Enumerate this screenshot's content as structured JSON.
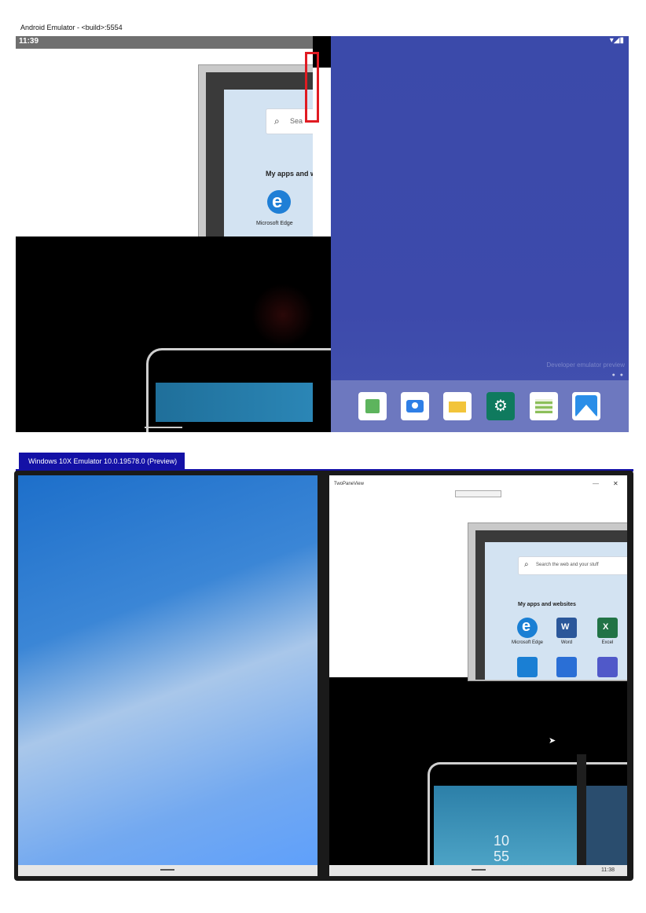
{
  "android": {
    "window_title": "Android Emulator - <build>:5554",
    "status_time": "11:39",
    "status_icons": "▾◢▮",
    "developer_preview": "Developer emulator preview",
    "page_dots": "● ●",
    "zoom": {
      "search_placeholder": "Sea",
      "section_title": "My apps and w",
      "edge_label": "Microsoft Edge"
    },
    "dock_apps": [
      {
        "name": "Phone/Contacts",
        "color": "#ffffff"
      },
      {
        "name": "Camera",
        "color": "#ffffff"
      },
      {
        "name": "Email",
        "color": "#ffffff"
      },
      {
        "name": "Settings",
        "color": "#0f7a5e"
      },
      {
        "name": "Spreadsheet",
        "color": "#ffffff"
      },
      {
        "name": "Photos",
        "color": "#ffffff"
      }
    ]
  },
  "windows": {
    "tab_title": "Windows 10X Emulator 10.0.19578.0 (Preview)",
    "app_title": "TwoPaneView",
    "window_minimize": "—",
    "window_close": "✕",
    "search_placeholder": "Search the web and your stuff",
    "section_title": "My apps and websites",
    "apps": [
      {
        "label": "Microsoft Edge",
        "color": "#1a7fd4"
      },
      {
        "label": "Word",
        "color": "#2b579a"
      },
      {
        "label": "Excel",
        "color": "#217346"
      }
    ],
    "lock_time_hour": "10",
    "lock_time_min": "55",
    "taskbar_time": "11:38",
    "accent": "#1411a6"
  }
}
